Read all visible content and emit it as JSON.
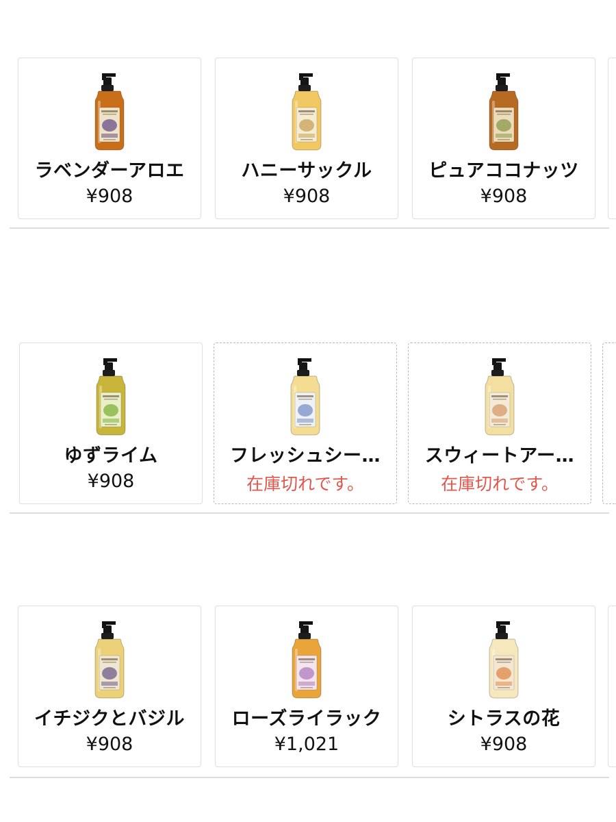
{
  "products": [
    {
      "name": "ラベンダーアロエ",
      "price": "¥908",
      "stock": "",
      "liquid": "#c96f1a",
      "label": "#efe3c7",
      "accent": "#6b4f8c"
    },
    {
      "name": "ハニーサックル",
      "price": "¥908",
      "stock": "",
      "liquid": "#f1c861",
      "label": "#f4ecd3",
      "accent": "#caa35a"
    },
    {
      "name": "ピュアココナッツ",
      "price": "¥908",
      "stock": "",
      "liquid": "#b76a22",
      "label": "#ecdcb9",
      "accent": "#8a9a4a"
    },
    {
      "name": "ゆずライム",
      "price": "¥908",
      "stock": "",
      "liquid": "#c8b53a",
      "label": "#e8efc9",
      "accent": "#7fb33a"
    },
    {
      "name": "フレッシュシー…",
      "price": "",
      "stock": "在庫切れです。",
      "liquid": "#f4dd92",
      "label": "#eef1f5",
      "accent": "#7a8fc7"
    },
    {
      "name": "スウィートアー…",
      "price": "",
      "stock": "在庫切れです。",
      "liquid": "#f3dfa0",
      "label": "#f4ead8",
      "accent": "#d79a6a"
    },
    {
      "name": "イチジクとバジル",
      "price": "¥908",
      "stock": "",
      "liquid": "#ecd178",
      "label": "#efe6d2",
      "accent": "#6e5b8a"
    },
    {
      "name": "ローズライラック",
      "price": "¥1,021",
      "stock": "",
      "liquid": "#e9a43a",
      "label": "#f4e4ee",
      "accent": "#b07cbf"
    },
    {
      "name": "シトラスの花",
      "price": "¥908",
      "stock": "",
      "liquid": "#f6e7bd",
      "label": "#f3e7d3",
      "accent": "#e08a4a"
    }
  ],
  "colors": {
    "out_of_stock": "#e2574c",
    "border": "#dedede",
    "separator": "#dcdcdc"
  }
}
